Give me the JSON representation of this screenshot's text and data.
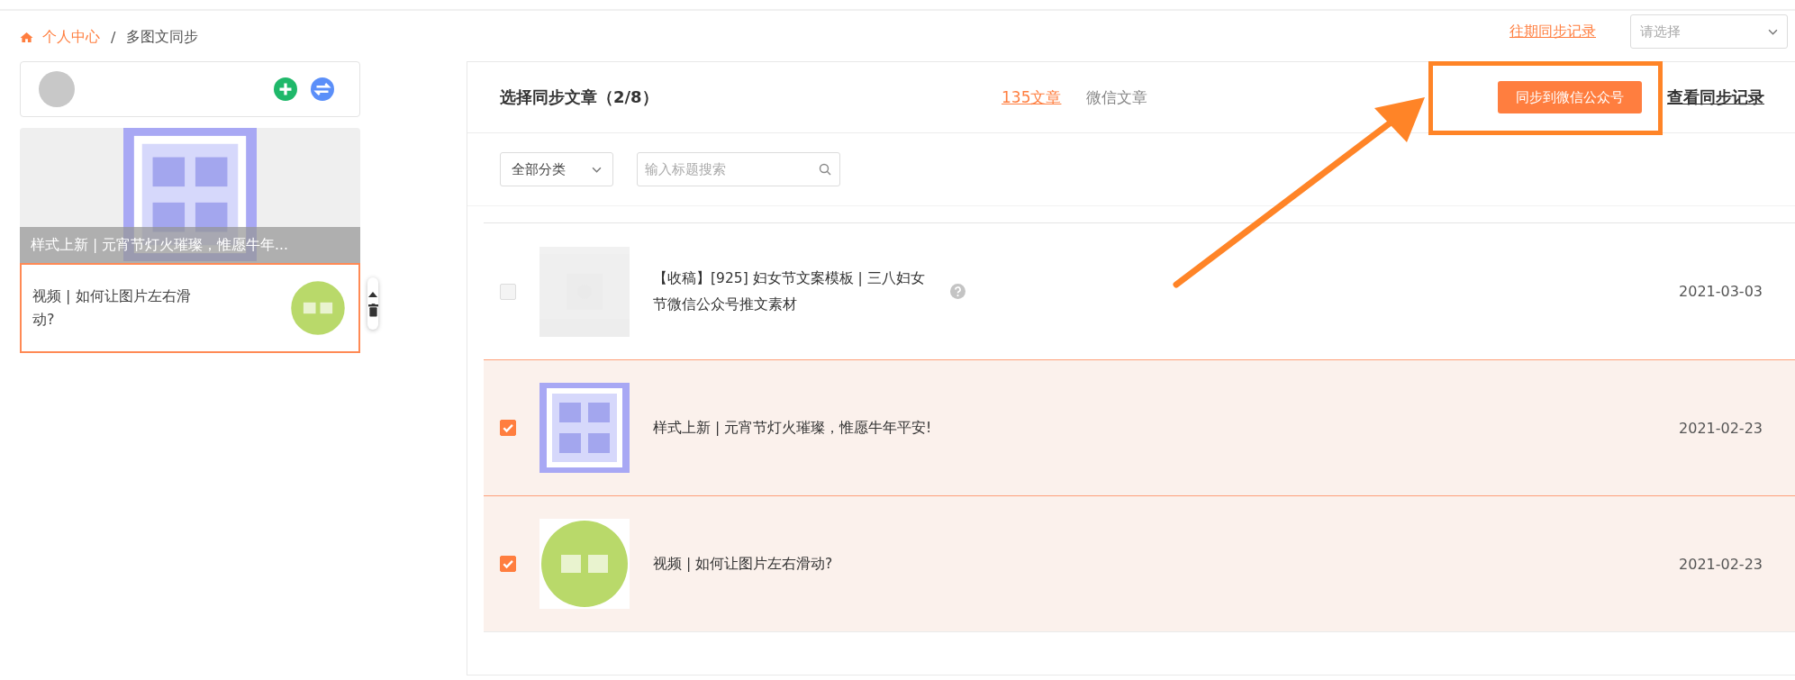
{
  "breadcrumb": {
    "items": [
      {
        "label": "个人中心",
        "kind": "link"
      },
      {
        "label": "多图文同步",
        "kind": "current"
      }
    ],
    "separator": "/"
  },
  "history_link": "往期同步记录",
  "account_select": {
    "placeholder": "请选择"
  },
  "left_panel": {
    "articles": [
      {
        "title": "样式上新 | 元宵节灯火璀璨，惟愿牛年...",
        "kind": "cover"
      },
      {
        "title": "视频 | 如何让图片左右滑动?",
        "kind": "item",
        "selected": true
      }
    ]
  },
  "main": {
    "title": "选择同步文章（2/8）",
    "tabs": [
      {
        "label": "135文章",
        "selected": true
      },
      {
        "label": "微信文章",
        "selected": false
      }
    ],
    "sync_button": "同步到微信公众号",
    "records_link": "查看同步记录",
    "category_select": {
      "value": "全部分类"
    },
    "search": {
      "placeholder": "输入标题搜索"
    },
    "rows": [
      {
        "title": "【收稿】[925] 妇女节文案模板 | 三八妇女节微信公众号推文素材",
        "date": "2021-03-03",
        "checked": false,
        "help": true
      },
      {
        "title": "样式上新 | 元宵节灯火璀璨，惟愿牛年平安!",
        "date": "2021-02-23",
        "checked": true,
        "help": false
      },
      {
        "title": "视频 | 如何让图片左右滑动?",
        "date": "2021-02-23",
        "checked": true,
        "help": false
      }
    ]
  }
}
